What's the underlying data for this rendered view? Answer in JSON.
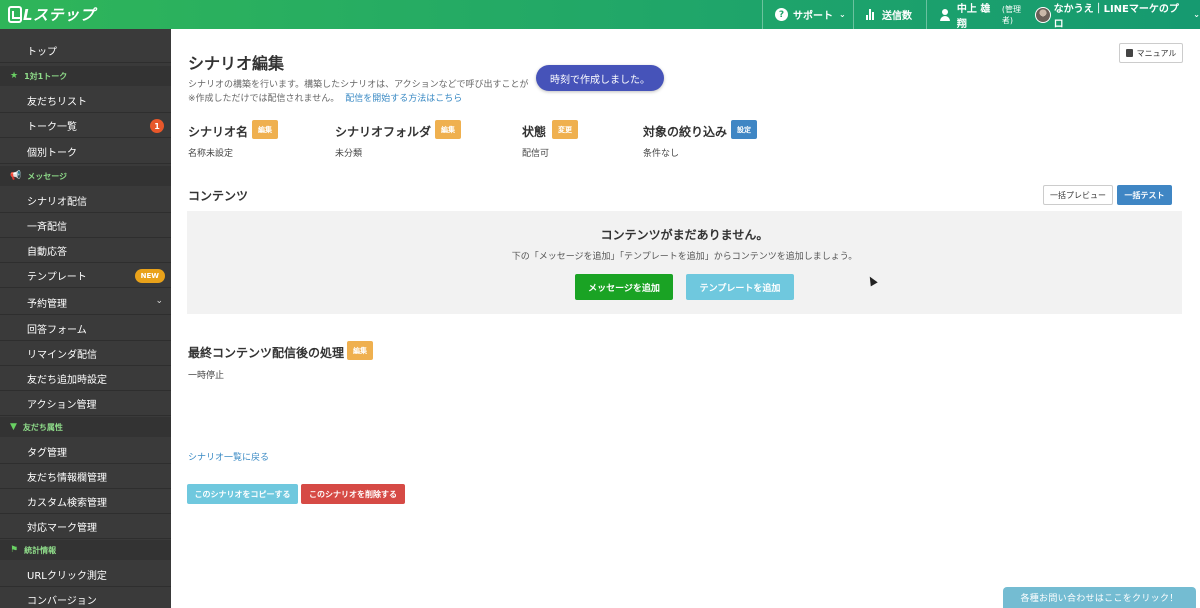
{
  "header": {
    "logo": "Lステップ",
    "support_label": "サポート",
    "send_count_label": "送信数",
    "user_name": "中上 雄翔",
    "user_role": "(管理者)",
    "account_name": "なかうえ｜LINEマーケのプロ"
  },
  "sidebar": {
    "top": "トップ",
    "sec_1on1": "1対1トーク",
    "friends_list": "友だちリスト",
    "talk_list": "トーク一覧",
    "talk_list_badge": "1",
    "individual_talk": "個別トーク",
    "sec_message": "メッセージ",
    "scenario": "シナリオ配信",
    "broadcast": "一斉配信",
    "auto_reply": "自動応答",
    "template": "テンプレート",
    "template_badge": "NEW",
    "reservation": "予約管理",
    "answer_form": "回答フォーム",
    "reminder": "リマインダ配信",
    "friend_add_setting": "友だち追加時設定",
    "action_mgmt": "アクション管理",
    "sec_attributes": "友だち属性",
    "tag_mgmt": "タグ管理",
    "info_field_mgmt": "友だち情報欄管理",
    "custom_search": "カスタム検索管理",
    "mark_mgmt": "対応マーク管理",
    "sec_stats": "統計情報",
    "url_click": "URLクリック測定",
    "conversion": "コンバージョン"
  },
  "main": {
    "title": "シナリオ編集",
    "desc_line1": "シナリオの構築を行います。構築したシナリオは、アクションなどで呼び出すことが",
    "desc_line2": "※作成しただけでは配信されません。",
    "desc_link": "配信を開始する方法はこちら",
    "toast": "時刻で作成しました。",
    "manual_label": "マニュアル",
    "meta": [
      {
        "label": "シナリオ名",
        "button": "編集",
        "value": "名称未設定"
      },
      {
        "label": "シナリオフォルダ",
        "button": "編集",
        "value": "未分類"
      },
      {
        "label": "状態",
        "button": "変更",
        "value": "配信可"
      },
      {
        "label": "対象の絞り込み",
        "button": "設定",
        "value": "条件なし"
      }
    ],
    "contents_title": "コンテンツ",
    "bulk_preview": "一括プレビュー",
    "bulk_test": "一括テスト",
    "empty_title": "コンテンツがまだありません。",
    "empty_sub": "下の「メッセージを追加」「テンプレートを追加」からコンテンツを追加しましょう。",
    "add_message": "メッセージを追加",
    "add_template": "テンプレートを追加",
    "final_title": "最終コンテンツ配信後の処理",
    "final_button": "編集",
    "final_value": "一時停止",
    "back_link": "シナリオ一覧に戻る",
    "copy_button": "このシナリオをコピーする",
    "delete_button": "このシナリオを削除する",
    "contact_button": "各種お問い合わせはここをクリック！"
  },
  "colors": {
    "header_green": "#1fa56a",
    "sidebar_bg": "#3a3a3a",
    "toast_blue": "#4653b9",
    "edit_orange": "#efb04f",
    "setting_blue": "#3f86c4",
    "add_green": "#1aa324",
    "delete_red": "#d64a45"
  }
}
